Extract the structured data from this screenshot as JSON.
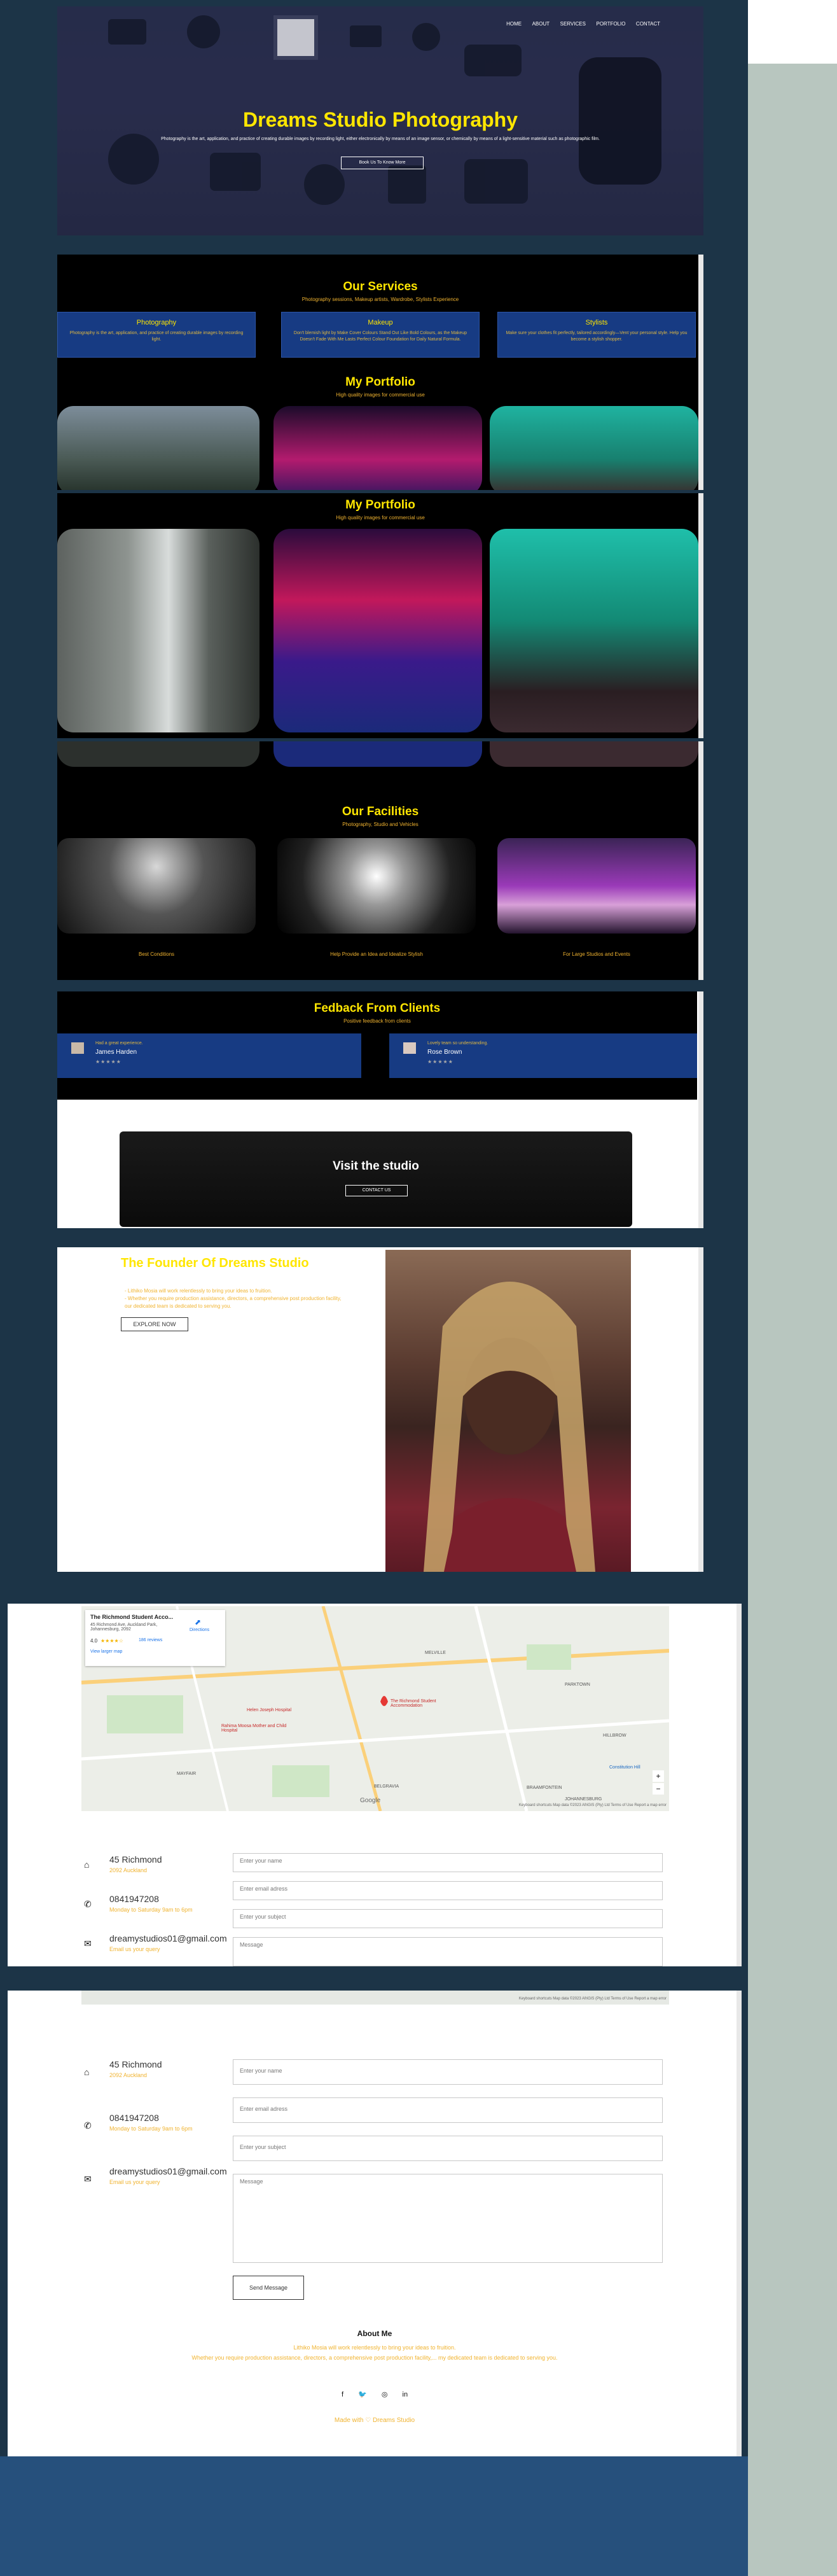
{
  "nav": {
    "items": [
      "HOME",
      "ABOUT",
      "SERVICES",
      "PORTFOLIO",
      "CONTACT"
    ]
  },
  "hero": {
    "title": "Dreams Studio Photography",
    "subtitle": "Photography is the art, application, and practice of creating durable images by recording light, either electronically by means of an image sensor, or chemically by means of a light-sensitive material such as photographic film.",
    "button": "Book Us To Know More"
  },
  "services": {
    "title": "Our Services",
    "subtitle": "Photography sessions, Makeup artists, Wardrobe, Stylists Experience",
    "items": [
      {
        "title": "Photography",
        "desc": "Photography is the art, application, and practice of creating durable images by recording light."
      },
      {
        "title": "Makeup",
        "desc": "Don't blemish light by Make Cover Colours Stand Out Like Bold Colours, as the Makeup Doesn't Fade With Me Lasts Perfect Colour Foundation for Daily Natural Formula."
      },
      {
        "title": "Stylists",
        "desc": "Make sure your clothes fit perfectly, tailored accordingly—Vent your personal style. Help you become a stylish shopper."
      }
    ]
  },
  "portfolio": {
    "title": "My Portfolio",
    "subtitle": "High quality images for commercial use"
  },
  "facilities": {
    "title": "Our Facilities",
    "subtitle": "Photography, Studio and Vehicles",
    "items": [
      {
        "caption": "Best Conditions"
      },
      {
        "caption": "Help Provide an Idea and Idealize Stylish"
      },
      {
        "caption": "For Large Studios and Events"
      }
    ]
  },
  "feedback": {
    "title": "Fedback From Clients",
    "subtitle": "Positive feedback from clients",
    "items": [
      {
        "quote": "Had a great experience.",
        "name": "James Harden",
        "stars": "★★★★★"
      },
      {
        "quote": "Lovely team so understanding.",
        "name": "Rose Brown",
        "stars": "★★★★★"
      }
    ]
  },
  "visit": {
    "title": "Visit the studio",
    "button": "CONTACT US"
  },
  "founder": {
    "title": "The Founder Of Dreams Studio",
    "line1": "- Lithiko Mosia will work relentlessly to bring your ideas to fruition.",
    "line2": "- Whether you require production assistance, directors, a comprehensive post production facility,",
    "line3": "our dedicated team is dedicated to serving you.",
    "button": "EXPLORE NOW"
  },
  "map": {
    "place": "The Richmond Student Acco...",
    "address": "45 Richmond Ave, Auckland Park, Johannesburg, 2092",
    "rating": "4.0",
    "stars": "★★★★☆",
    "reviews": "186 reviews",
    "directions": "Directions",
    "view_larger": "View larger map",
    "labels": [
      "MELVILLE",
      "BRAAMFONTEIN",
      "JOHANNESBURG",
      "HILLBROW",
      "BELGRAVIA",
      "PARKTOWN",
      "MAYFAIR",
      "Wits Art Museum",
      "Melville Koppies Nature Reserve",
      "The Richmond Student Accommodation",
      "Helen Joseph Hospital",
      "Rahima Moosa Mother and Child Hospital",
      "Johannesburg",
      "Constitution Hill",
      "Campus Central Student Accommodation"
    ],
    "google": "Google",
    "footer": "Keyboard shortcuts   Map data ©2023 AfriGIS (Pty) Ltd   Terms of Use   Report a map error"
  },
  "contact": {
    "address_main": "45 Richmond",
    "address_sub": "2092 Auckland",
    "phone_main": "0841947208",
    "phone_sub": "Monday to Saturday 9am to 6pm",
    "email_main": "dreamystudios01@gmail.com",
    "email_sub": "Email us your query",
    "name_placeholder": "Enter your name",
    "email_placeholder": "Enter email adress",
    "subject_placeholder": "Enter your subject",
    "message_placeholder": "Message",
    "send": "Send Message"
  },
  "about": {
    "title": "About Me",
    "line1": "Lithiko Mosia will work relentlessly to bring your ideas to fruition.",
    "line2": "Whether you require production assistance, directors, a comprehensive post production facility,... my dedicated team is dedicated to serving you.",
    "social": [
      "f",
      "🐦",
      "◎",
      "in"
    ],
    "credit": "Made with ♡ Dreams Studio"
  },
  "colors": {
    "accent": "#ffe600",
    "gold": "#f0b330",
    "navy": "#173b83",
    "page_bg": "#1c3447"
  }
}
